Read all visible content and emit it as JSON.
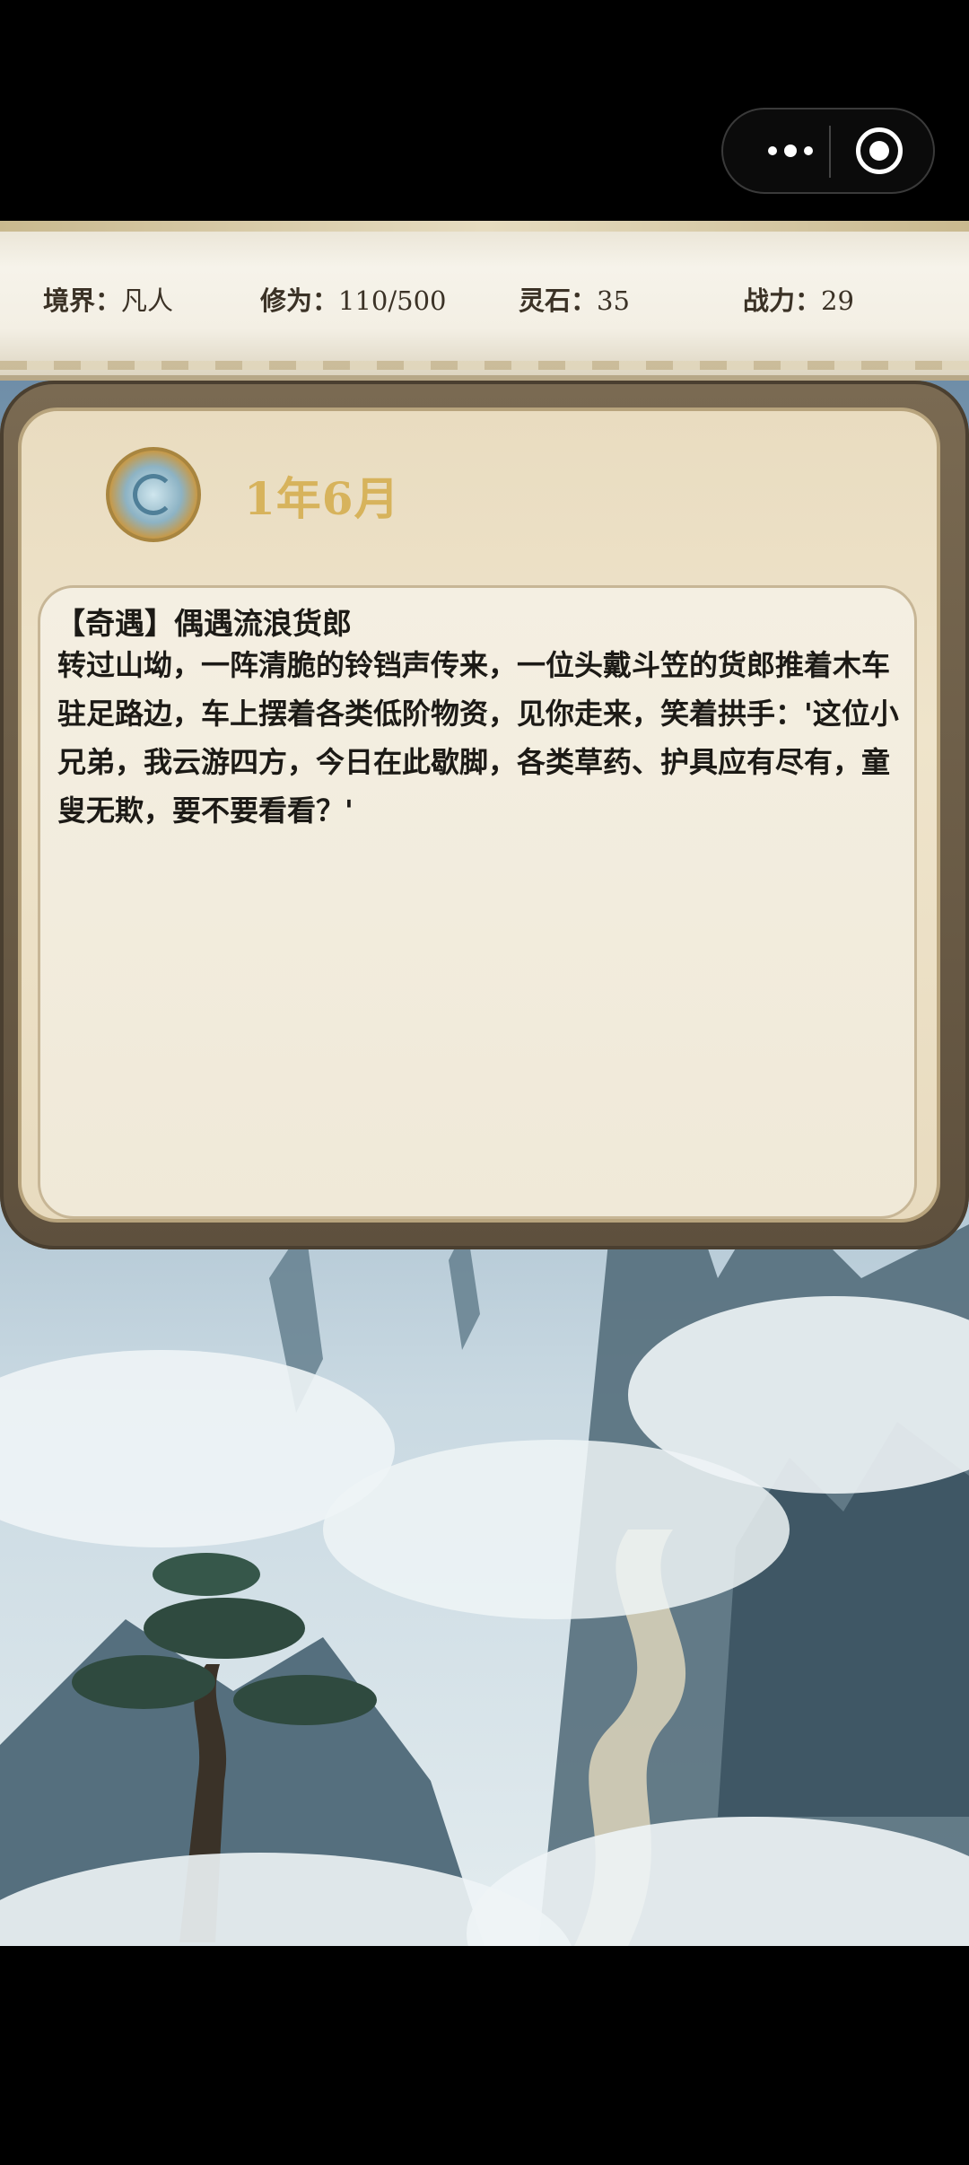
{
  "stats": {
    "realm_label": "境界：",
    "realm_value": "凡人",
    "cultivation_label": "修为：",
    "cultivation_value": "110/500",
    "spirit_stone_label": "灵石：",
    "spirit_stone_value": "35",
    "power_label": "战力：",
    "power_value": "29"
  },
  "event": {
    "date": "1年6月",
    "title": "【奇遇】偶遇流浪货郎",
    "body": "转过山坳，一阵清脆的铃铛声传来，一位头戴斗笠的货郎推着木车驻足路边，车上摆着各类低阶物资，见你走来，笑着拱手：'这位小兄弟，我云游四方，今日在此歇脚，各类草药、护具应有尽有，童叟无欺，要不要看看？'"
  },
  "icons": {
    "capsule_menu": "more-dots-icon",
    "capsule_close": "close-target-icon",
    "event_emblem": "spiral-emblem-icon"
  },
  "colors": {
    "date_gold": "#d7b35c",
    "parchment": "#efe4cb",
    "text": "#1c1a16"
  }
}
